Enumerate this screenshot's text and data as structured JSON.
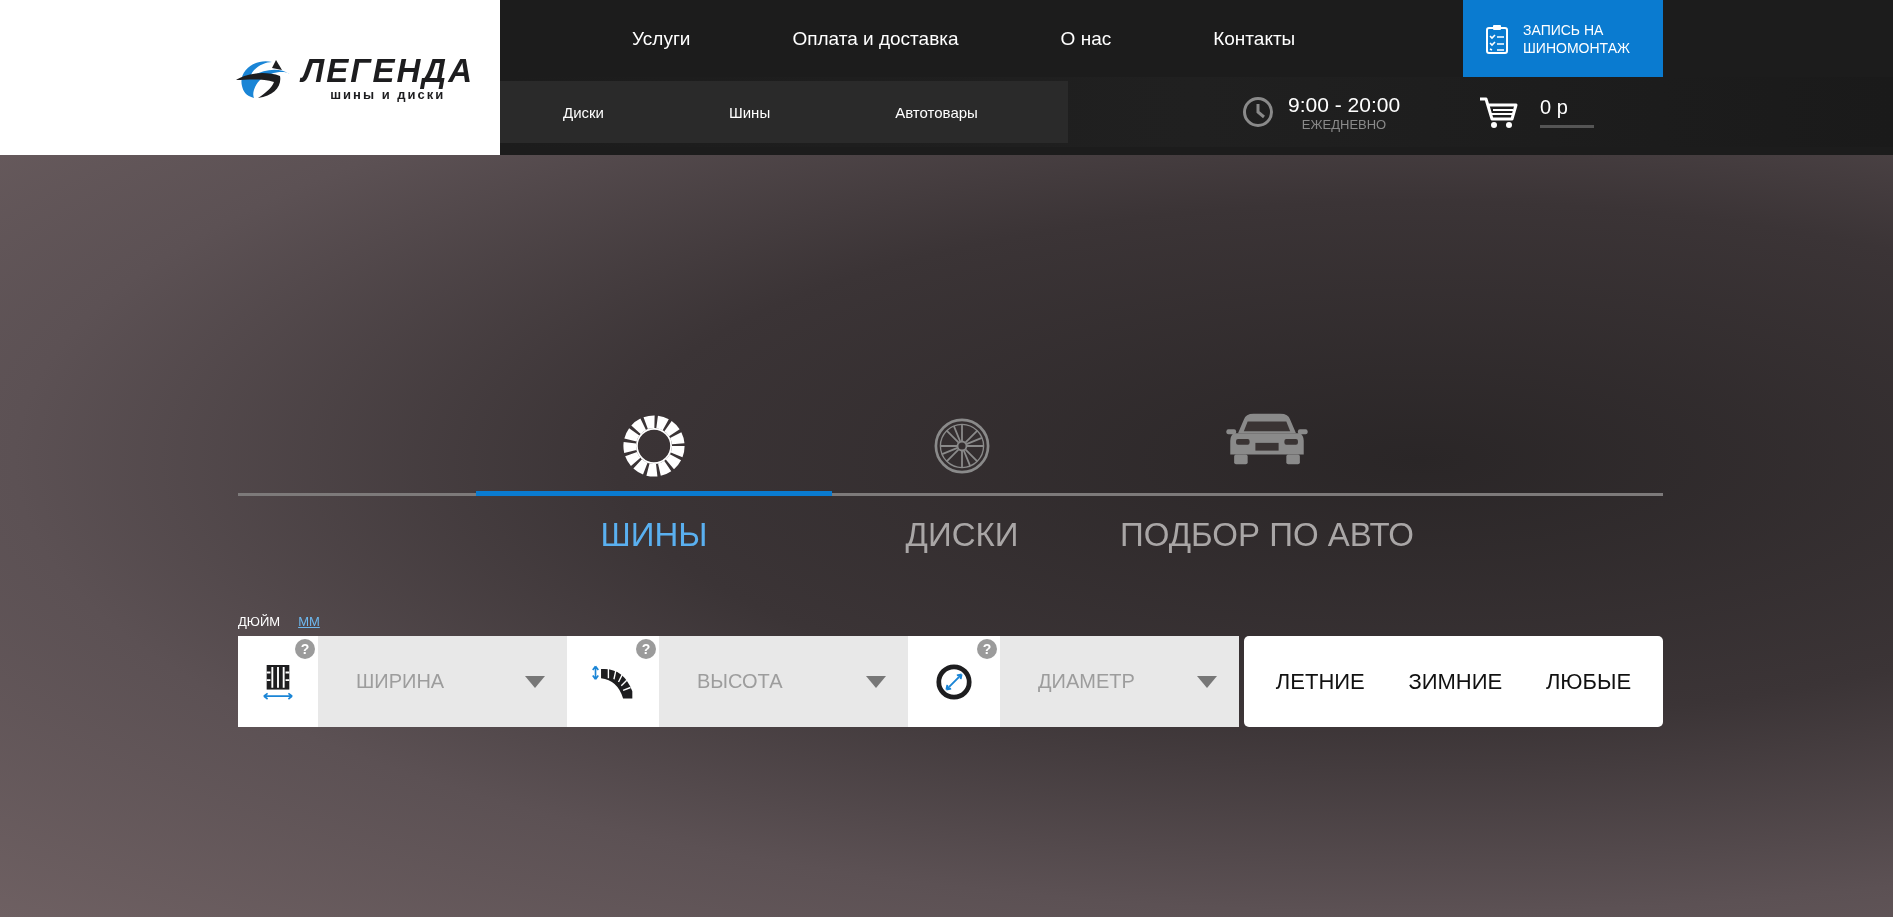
{
  "logo": {
    "name": "ЛЕГЕНДА",
    "tagline": "шины и диски"
  },
  "nav": [
    "Услуги",
    "Оплата и доставка",
    "О нас",
    "Контакты"
  ],
  "booking_button": {
    "line1": "ЗАПИСЬ НА",
    "line2": "ШИНОМОНТАЖ"
  },
  "subnav": [
    "Диски",
    "Шины",
    "Автотовары"
  ],
  "hours": {
    "time": "9:00 - 20:00",
    "days": "ЕЖЕДНЕВНО"
  },
  "cart": {
    "total": "0 р"
  },
  "tabs": [
    {
      "label": "ШИНЫ",
      "kind": "tire",
      "selected": true
    },
    {
      "label": "ДИСКИ",
      "kind": "wheel",
      "selected": false
    },
    {
      "label": "ПОДБОР ПО АВТО",
      "kind": "car",
      "selected": false
    }
  ],
  "units": [
    {
      "label": "ДЮЙМ",
      "selected": true
    },
    {
      "label": "ММ",
      "selected": false
    }
  ],
  "filters": [
    {
      "kind": "width",
      "placeholder": "ШИРИНА",
      "help": "?"
    },
    {
      "kind": "height",
      "placeholder": "ВЫСОТА",
      "help": "?"
    },
    {
      "kind": "diameter",
      "placeholder": "ДИАМЕТР",
      "help": "?"
    }
  ],
  "seasons": [
    "ЛЕТНИЕ",
    "ЗИМНИЕ",
    "ЛЮБЫЕ"
  ]
}
